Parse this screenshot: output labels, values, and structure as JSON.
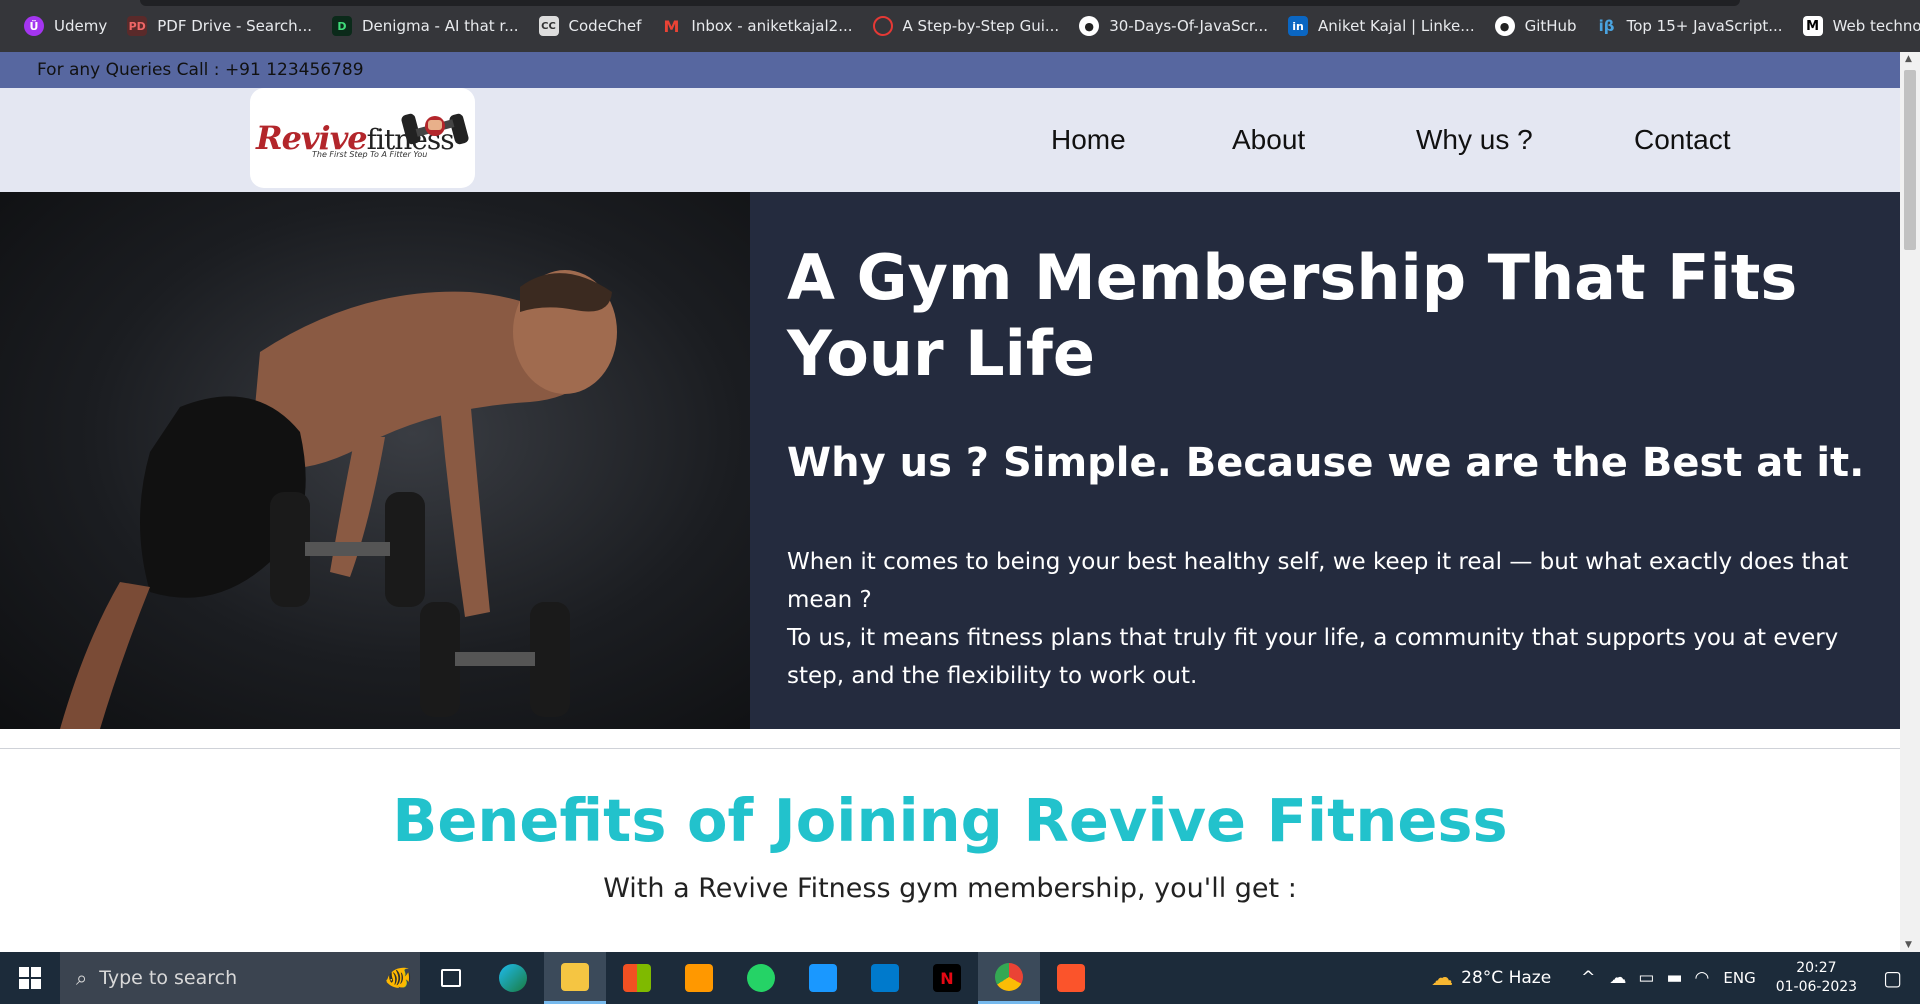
{
  "bookmarks": [
    {
      "label": "Udemy",
      "icon": "udemy-icon",
      "color": "#a435f0"
    },
    {
      "label": "PDF Drive - Search...",
      "icon": "pdf-drive-icon",
      "color": "#c0392b"
    },
    {
      "label": "Denigma - AI that r...",
      "icon": "denigma-icon",
      "color": "#111111"
    },
    {
      "label": "CodeChef",
      "icon": "codechef-icon",
      "color": "#5b4638"
    },
    {
      "label": "Inbox - aniketkajal2...",
      "icon": "gmail-icon",
      "color": "#ea4335"
    },
    {
      "label": "A Step-by-Step Gui...",
      "icon": "guide-icon",
      "color": "#e53935"
    },
    {
      "label": "30-Days-Of-JavaScr...",
      "icon": "github-icon",
      "color": "#ffffff"
    },
    {
      "label": "Aniket Kajal | Linke...",
      "icon": "linkedin-icon",
      "color": "#0a66c2"
    },
    {
      "label": "GitHub",
      "icon": "github-icon",
      "color": "#ffffff"
    },
    {
      "label": "Top 15+ JavaScript...",
      "icon": "interviewbit-icon",
      "color": "#4aa3df"
    },
    {
      "label": "Web technology for...",
      "icon": "mdn-icon",
      "color": "#000000"
    }
  ],
  "topbar": {
    "text": "For any Queries Call : +91 123456789"
  },
  "logo": {
    "brand": "Revive",
    "brand_suffix": "fitness",
    "tagline": "The First Step To A Fitter You"
  },
  "nav": {
    "items": [
      "Home",
      "About",
      "Why us ?",
      "Contact"
    ]
  },
  "hero": {
    "title": "A Gym Membership That Fits Your Life",
    "subtitle": "Why us ? Simple. Because we are the Best at it.",
    "p1": "When it comes to being your best healthy self, we keep it real — but what exactly does that mean ?",
    "p2": "To us, it means fitness plans that truly fit your life, a community that supports you at every step, and the flexibility to work out."
  },
  "benefits": {
    "heading": "Benefits of Joining Revive Fitness",
    "subheading": "With a Revive Fitness gym membership, you'll get :"
  },
  "taskbar": {
    "search_placeholder": "Type to search",
    "weather": "28°C  Haze",
    "lang": "ENG",
    "time": "20:27",
    "date": "01-06-2023"
  },
  "colors": {
    "accent": "#22c2cc",
    "hero_bg": "#242b3e",
    "topbar": "#5767a0"
  }
}
